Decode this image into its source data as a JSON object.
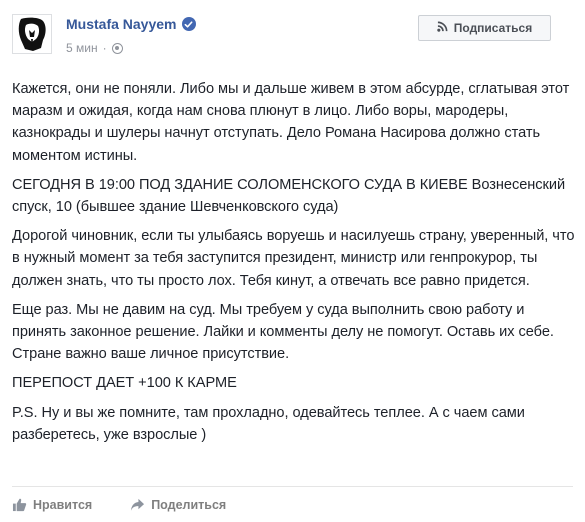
{
  "post": {
    "author": "Mustafa Nayyem",
    "time": "5 мин",
    "separator": "·",
    "subscribe_label": "Подписаться",
    "paragraphs": [
      "Кажется, они не поняли. Либо мы и дальше живем в этом абсурде, сглатывая этот маразм и ожидая, когда нам снова плюнут в лицо. Либо воры, мародеры, казнокрады и шулеры начнут отступать. Дело Романа Насирова должно стать моментом истины.",
      "СЕГОДНЯ В 19:00 ПОД ЗДАНИЕ СОЛОМЕНСКОГО СУДА В КИЕВЕ Вознесенский спуск, 10 (бывшее здание Шевченковского суда)",
      "Дорогой чиновник, если ты улыбаясь воруешь и насилуешь страну, уверенный, что в нужный момент за тебя заступится президент, министр или генпрокурор, ты должен знать, что ты просто лох. Тебя кинут, а отвечать все равно придется.",
      "Еще раз. Мы не давим на суд. Мы требуем у суда выполнить свою работу и принять законное решение. Лайки и комменты делу не помогут. Оставь их себе. Стране важно ваше личное присутствие.",
      "ПЕРЕПОСТ ДАЕТ +100 К КАРМЕ",
      "P.S. Ну и вы же помните, там прохладно, одевайтесь теплее. А с чаем сами разберетесь, уже взрослые )"
    ]
  },
  "actions": {
    "like_label": "Нравится",
    "share_label": "Поделиться"
  },
  "colors": {
    "link": "#365899",
    "meta": "#90949c",
    "text": "#1d2129",
    "action": "#7f7f7f",
    "verified": "#4267b2"
  },
  "icons": [
    "avatar",
    "verified-icon",
    "globe-icon",
    "rss-icon",
    "like-icon",
    "share-icon"
  ]
}
